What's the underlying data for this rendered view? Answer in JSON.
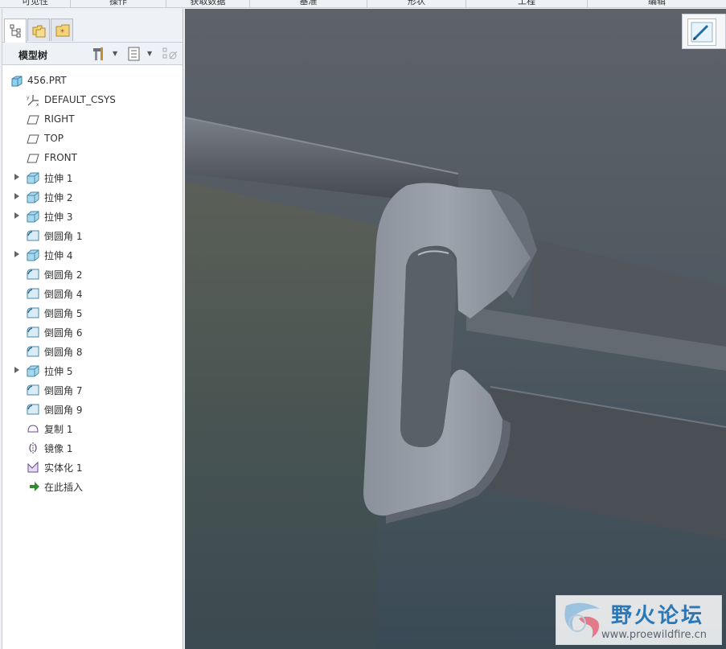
{
  "ribbon": {
    "groups": [
      "可见性",
      "操作",
      "获取数据",
      "基准",
      "形状",
      "工程",
      "编辑"
    ]
  },
  "panel": {
    "title": "模型树",
    "tabs": [
      "model-tree-tab",
      "folder-browser-tab",
      "favorites-tab"
    ]
  },
  "tree": {
    "root": "456.PRT",
    "items": [
      {
        "label": "DEFAULT_CSYS",
        "icon": "csys-icon",
        "expandable": false
      },
      {
        "label": "RIGHT",
        "icon": "datum-plane-icon",
        "expandable": false
      },
      {
        "label": "TOP",
        "icon": "datum-plane-icon",
        "expandable": false
      },
      {
        "label": "FRONT",
        "icon": "datum-plane-icon",
        "expandable": false
      },
      {
        "label": "拉伸 1",
        "icon": "extrude-icon",
        "expandable": true
      },
      {
        "label": "拉伸 2",
        "icon": "extrude-icon",
        "expandable": true
      },
      {
        "label": "拉伸 3",
        "icon": "extrude-icon",
        "expandable": true
      },
      {
        "label": "倒圆角 1",
        "icon": "round-icon",
        "expandable": false
      },
      {
        "label": "拉伸 4",
        "icon": "extrude-icon",
        "expandable": true
      },
      {
        "label": "倒圆角 2",
        "icon": "round-icon",
        "expandable": false
      },
      {
        "label": "倒圆角 4",
        "icon": "round-icon",
        "expandable": false
      },
      {
        "label": "倒圆角 5",
        "icon": "round-icon",
        "expandable": false
      },
      {
        "label": "倒圆角 6",
        "icon": "round-icon",
        "expandable": false
      },
      {
        "label": "倒圆角 8",
        "icon": "round-icon",
        "expandable": false
      },
      {
        "label": "拉伸 5",
        "icon": "extrude-icon",
        "expandable": true
      },
      {
        "label": "倒圆角 7",
        "icon": "round-icon",
        "expandable": false
      },
      {
        "label": "倒圆角 9",
        "icon": "round-icon",
        "expandable": false
      },
      {
        "label": "复制 1",
        "icon": "copy-surface-icon",
        "expandable": false
      },
      {
        "label": "镜像 1",
        "icon": "mirror-icon",
        "expandable": false
      },
      {
        "label": "实体化 1",
        "icon": "solidify-icon",
        "expandable": false
      },
      {
        "label": "在此插入",
        "icon": "insert-here-arrow-icon",
        "expandable": false
      }
    ]
  },
  "watermark": {
    "title": "野火论坛",
    "url": "www.proewildfire.cn"
  },
  "colors": {
    "viewport_top": "#5d6168",
    "viewport_bottom": "#3b4a56",
    "model": "#8d939c",
    "accent": "#2b78b8"
  }
}
